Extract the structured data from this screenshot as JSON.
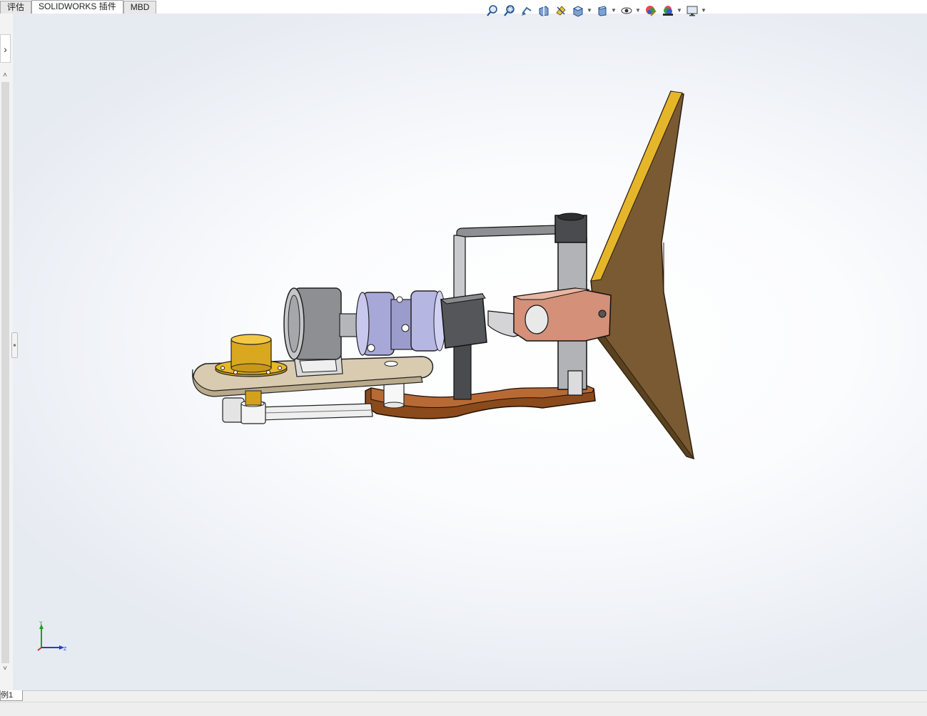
{
  "tabs": [
    {
      "label": "评估",
      "active": false
    },
    {
      "label": "SOLIDWORKS 插件",
      "active": true
    },
    {
      "label": "MBD",
      "active": false
    }
  ],
  "hud_toolbar": {
    "items": [
      {
        "icon": "zoom-to-fit-icon",
        "has_dropdown": false
      },
      {
        "icon": "zoom-to-area-icon",
        "has_dropdown": false
      },
      {
        "icon": "previous-view-icon",
        "has_dropdown": false
      },
      {
        "icon": "section-view-icon",
        "has_dropdown": false
      },
      {
        "icon": "dynamic-annotation-icon",
        "has_dropdown": false
      },
      {
        "icon": "view-orientation-icon",
        "has_dropdown": true
      },
      {
        "icon": "display-style-icon",
        "has_dropdown": true
      },
      {
        "icon": "hide-show-items-icon",
        "has_dropdown": true
      },
      {
        "icon": "edit-appearance-icon",
        "has_dropdown": false
      },
      {
        "icon": "apply-scene-icon",
        "has_dropdown": true
      },
      {
        "icon": "view-settings-icon",
        "has_dropdown": true
      }
    ]
  },
  "triad": {
    "x_label": "Z",
    "y_label": "Y"
  },
  "config_tab": {
    "label": "例1"
  },
  "colors": {
    "fin": "#7a5a33",
    "fin_edge": "#e6b62a",
    "base_plate": "#d9cbb0",
    "lower_link": "#8b4a1c",
    "bearing": "#d4a11a",
    "clamp": "#d49079",
    "axis_x": "#d03030",
    "axis_y": "#20a020",
    "axis_z": "#2040c0"
  }
}
